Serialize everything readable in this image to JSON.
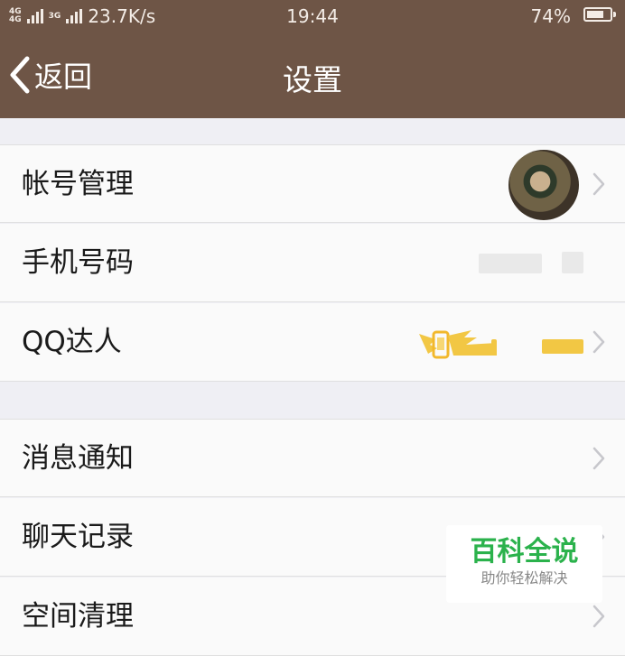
{
  "status_bar": {
    "network_1": "4G",
    "network_2": "4G",
    "network_3": "3G",
    "speed": "23.7K/s",
    "time": "19:44",
    "battery": "74%",
    "battery_level": 0.74
  },
  "nav": {
    "back_label": "返回",
    "title": "设置"
  },
  "section1": {
    "account": "帐号管理",
    "phone": "手机号码",
    "qq_daren": "QQ达人"
  },
  "section2": {
    "notifications": "消息通知",
    "chat_history": "聊天记录",
    "storage_cleanup": "空间清理"
  },
  "watermark": {
    "title": "百科全说",
    "subtitle": "助你轻松解决"
  },
  "colors": {
    "header_bg": "#6e5546",
    "page_bg": "#efeff4",
    "row_bg": "#fafafa",
    "watermark_green": "#2bb24c",
    "badge_gold": "#f2c744"
  }
}
